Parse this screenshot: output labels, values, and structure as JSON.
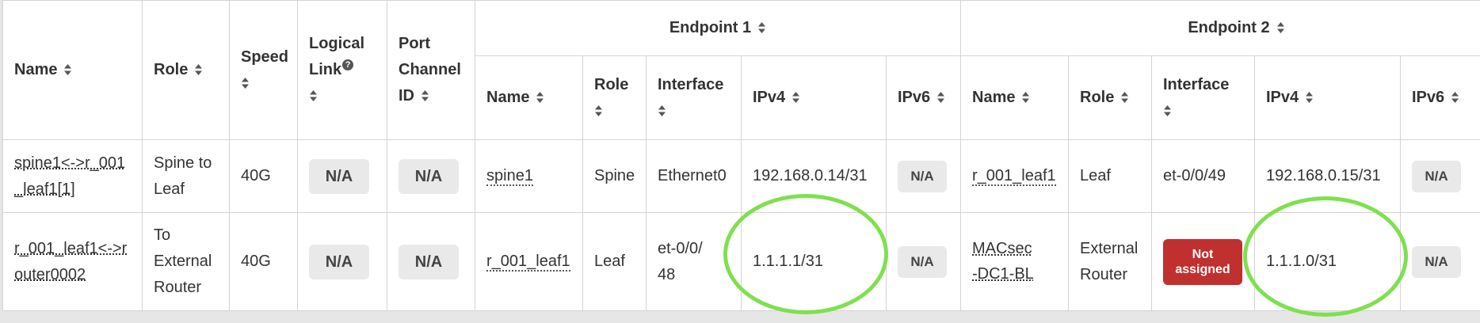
{
  "headers": {
    "name": "Name",
    "role": "Role",
    "speed": "Speed",
    "logical_link": "Logical Link",
    "port_channel_id": "Port Channel ID",
    "endpoint1": "Endpoint 1",
    "endpoint2": "Endpoint 2",
    "ep_name": "Name",
    "ep_role": "Role",
    "ep_interface": "Interface",
    "ep_ipv4": "IPv4",
    "ep_ipv6": "IPv6"
  },
  "icons": {
    "sort": "sort-icon",
    "help": "help-icon",
    "help_glyph": "?"
  },
  "rows": [
    {
      "name": "spine1<->r_001_leaf1[1]",
      "role": "Spine to Leaf",
      "speed": "40G",
      "logical_link": "N/A",
      "port_channel_id": "N/A",
      "ep1": {
        "name": "spine1",
        "role": "Spine",
        "interface": "Ethernet0",
        "ipv4": "192.168.0.14/31",
        "ipv6": "N/A"
      },
      "ep2": {
        "name": "r_001_leaf1",
        "role": "Leaf",
        "interface": "et-0/0/49",
        "ipv4": "192.168.0.15/31",
        "ipv6": "N/A"
      }
    },
    {
      "name": "r_001_leaf1<->router0002",
      "role": "To External Router",
      "speed": "40G",
      "logical_link": "N/A",
      "port_channel_id": "N/A",
      "ep1": {
        "name": "r_001_leaf1",
        "role": "Leaf",
        "interface": "et-0/0/48",
        "ipv4": "1.1.1.1/31",
        "ipv6": "N/A"
      },
      "ep2": {
        "name": "MACsec-DC1-BL",
        "role": "External Router",
        "interface": "Not assigned",
        "ipv4": "1.1.1.0/31",
        "ipv6": "N/A"
      }
    }
  ],
  "colors": {
    "highlight": "#7ee04e",
    "not_assigned": "#c0302e",
    "badge_bg": "#e9e9e9",
    "border": "#d4d4d4"
  }
}
